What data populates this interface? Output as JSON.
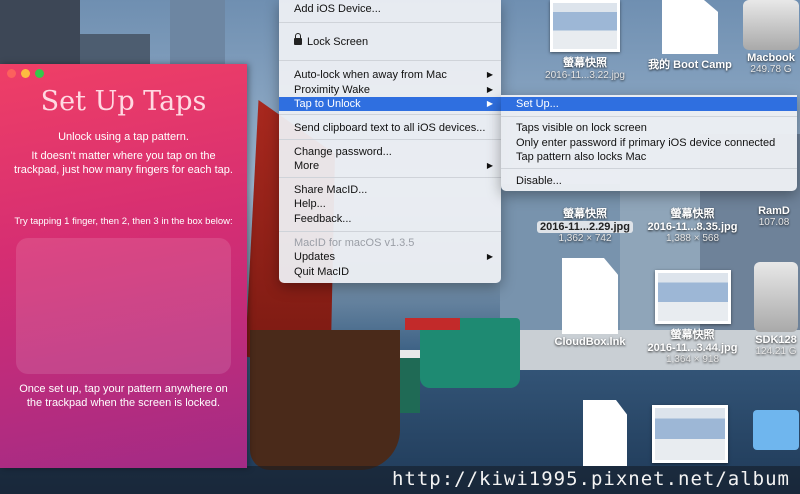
{
  "taps_window": {
    "title": "Set Up Taps",
    "line1": "Unlock using a tap pattern.",
    "line2": "It doesn't matter where you tap on the trackpad, just how many fingers for each tap.",
    "instruction": "Try tapping 1 finger, then 2, then 3 in the box below:",
    "footer": "Once set up, tap your pattern anywhere on the trackpad when the screen is locked."
  },
  "menu": {
    "add_ios": "Add iOS Device...",
    "lock_screen": "Lock Screen",
    "auto_lock": "Auto-lock when away from Mac",
    "proximity": "Proximity Wake",
    "tap_unlock": "Tap to Unlock",
    "send_clipboard": "Send clipboard text to all iOS devices...",
    "change_password": "Change password...",
    "more": "More",
    "share": "Share MacID...",
    "help": "Help...",
    "feedback": "Feedback...",
    "version": "MacID for macOS v1.3.5",
    "updates": "Updates",
    "quit": "Quit MacID"
  },
  "submenu": {
    "setup": "Set Up...",
    "visible": "Taps visible on lock screen",
    "only_enter": "Only enter password if primary iOS device connected",
    "also_locks": "Tap pattern also locks Mac",
    "disable": "Disable..."
  },
  "desktop_files": [
    {
      "name": "螢幕快照",
      "sub": "2016-11...3.22.jpg"
    },
    {
      "name": "我的 Boot Camp",
      "sub": ""
    },
    {
      "name": "Macbook",
      "sub": "249.78 G"
    },
    {
      "name": "螢幕快照",
      "sub": "2016-11...2.29.jpg",
      "dims": "1,362 × 742"
    },
    {
      "name": "螢幕快照",
      "sub": "2016-11...8.35.jpg",
      "dims": "1,388 × 568"
    },
    {
      "name": "RamD",
      "sub": "107.08"
    },
    {
      "name": "CloudBox.lnk",
      "sub": ""
    },
    {
      "name": "螢幕快照",
      "sub": "2016-11...3.44.jpg",
      "dims": "1,364 × 918"
    },
    {
      "name": "SDK128",
      "sub": "124.21 G"
    }
  ],
  "watermark": "http://kiwi1995.pixnet.net/album"
}
